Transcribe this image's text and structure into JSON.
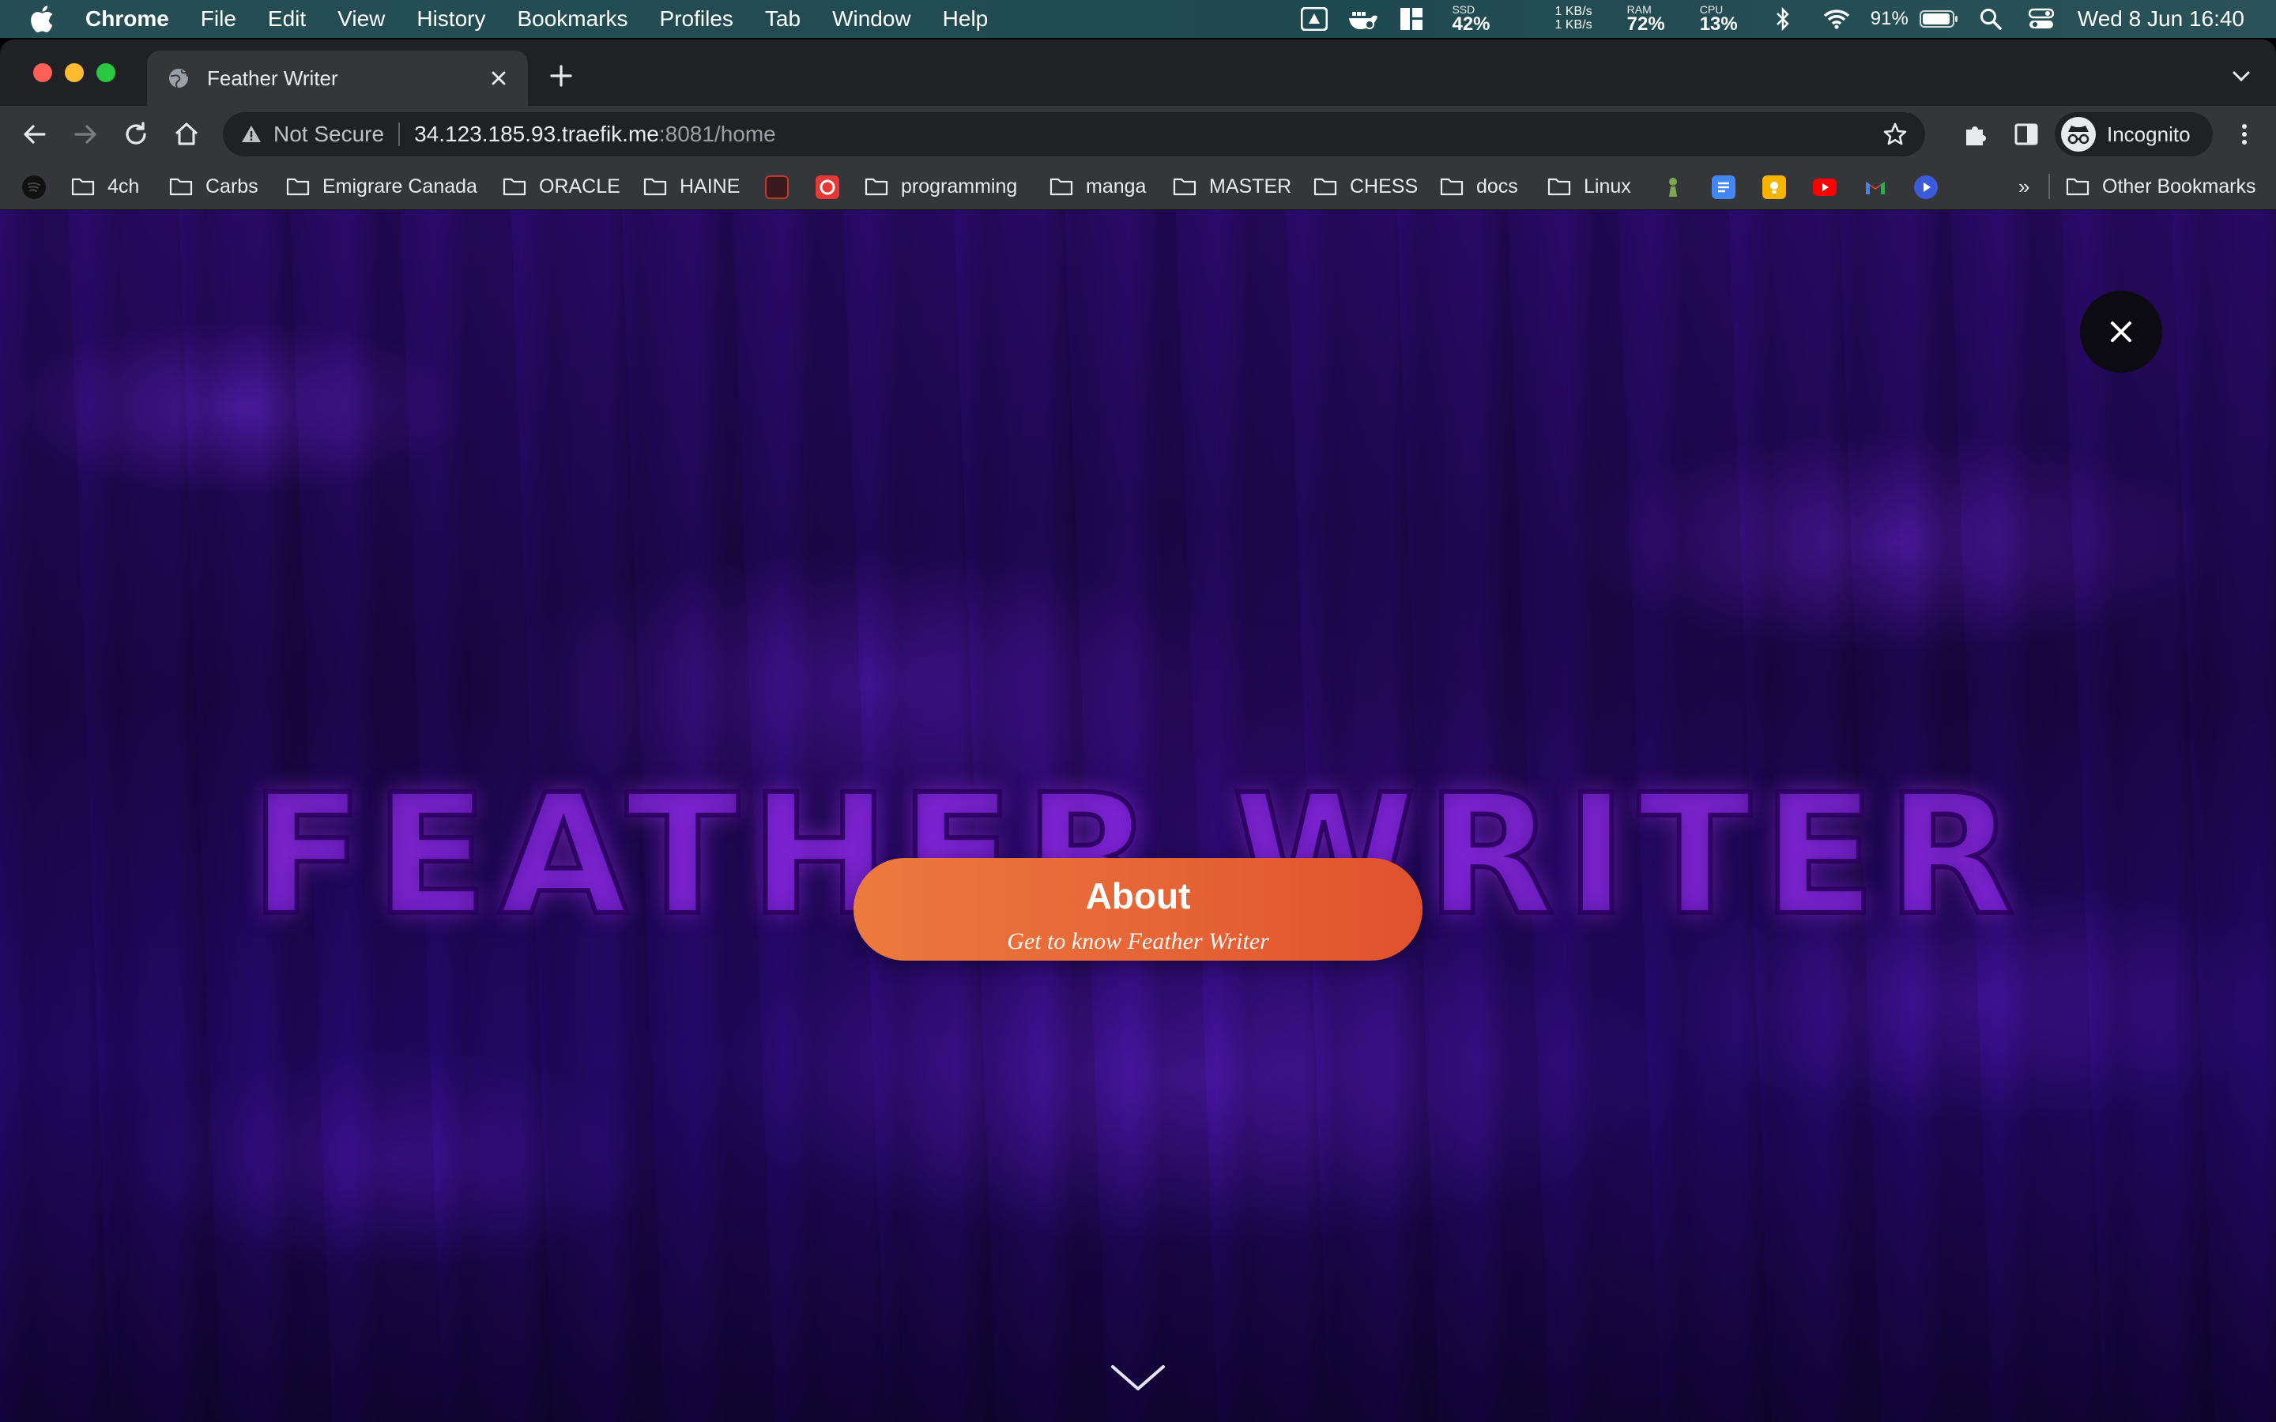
{
  "menubar": {
    "app": "Chrome",
    "menus": [
      "File",
      "Edit",
      "View",
      "History",
      "Bookmarks",
      "Profiles",
      "Tab",
      "Window",
      "Help"
    ],
    "ssd_label": "SSD",
    "ssd_value": "42%",
    "net_up": "1 KB/s",
    "net_down": "1 KB/s",
    "ram_label": "RAM",
    "ram_value": "72%",
    "cpu_label": "CPU",
    "cpu_value": "13%",
    "battery": "91%",
    "clock": "Wed 8 Jun  16:40"
  },
  "tab": {
    "title": "Feather Writer"
  },
  "address": {
    "security": "Not Secure",
    "host": "34.123.185.93.traefik.me",
    "path": ":8081/home"
  },
  "profile": {
    "label": "Incognito"
  },
  "bookmarks": {
    "items": [
      "4ch",
      "Carbs",
      "Emigrare Canada",
      "ORACLE",
      "HAINE",
      "programming",
      "manga",
      "MASTER",
      "CHESS",
      "docs",
      "Linux"
    ],
    "overflow": "»",
    "other": "Other Bookmarks"
  },
  "hero": {
    "title": "FEATHER WRITER",
    "button_title": "About",
    "button_subtitle": "Get to know Feather Writer"
  },
  "colors": {
    "accent_start": "#ec7a3e",
    "accent_end": "#e0522f",
    "background": "#24086a"
  }
}
